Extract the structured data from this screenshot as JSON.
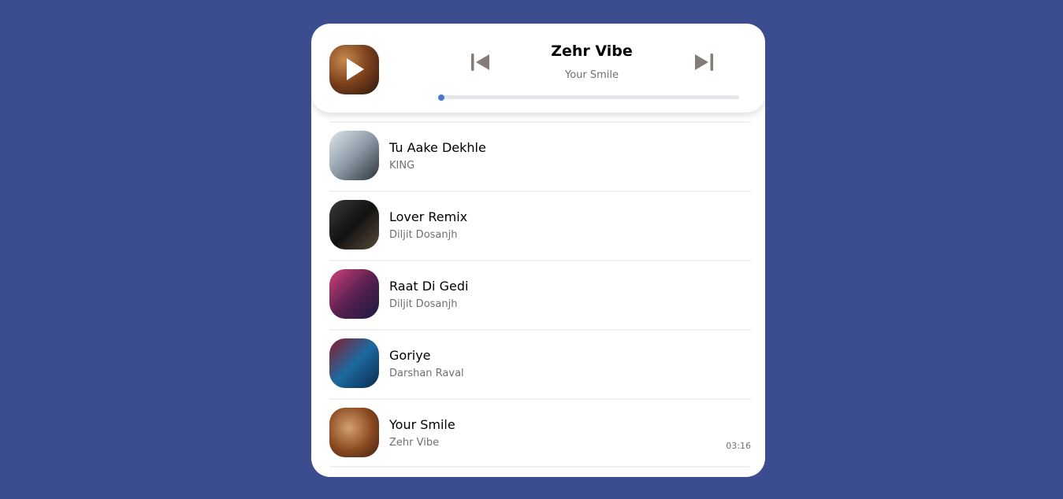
{
  "player": {
    "title": "Zehr Vibe",
    "subtitle": "Your Smile",
    "progress_percent": 0,
    "icons": {
      "play": "play-icon",
      "prev": "skip-previous-icon",
      "next": "skip-next-icon"
    },
    "accent": "#4a79c4"
  },
  "songs": [
    {
      "title": "Tu Aake Dekhle",
      "artist": "KING",
      "art": "linear-gradient(135deg,#dfe6ec,#8c9aa6 50%,#2c3238)",
      "time": ""
    },
    {
      "title": "Lover Remix",
      "artist": "Diljit Dosanjh",
      "art": "linear-gradient(135deg,#3a3a3a,#111 50%,#5a4a3a)",
      "time": ""
    },
    {
      "title": "Raat Di Gedi",
      "artist": "Diljit Dosanjh",
      "art": "linear-gradient(135deg,#d0427a,#5a2050 50%,#1a1a40)",
      "time": ""
    },
    {
      "title": "Goriye",
      "artist": "Darshan Raval",
      "art": "linear-gradient(135deg,#8a1a2a,#1c6aa0 50%,#0a2a50)",
      "time": ""
    },
    {
      "title": "Your Smile",
      "artist": "Zehr Vibe",
      "art": "radial-gradient(circle at 40% 40%,#d4a070,#8a4a20 55%,#3a2010)",
      "time": "03:16"
    }
  ]
}
